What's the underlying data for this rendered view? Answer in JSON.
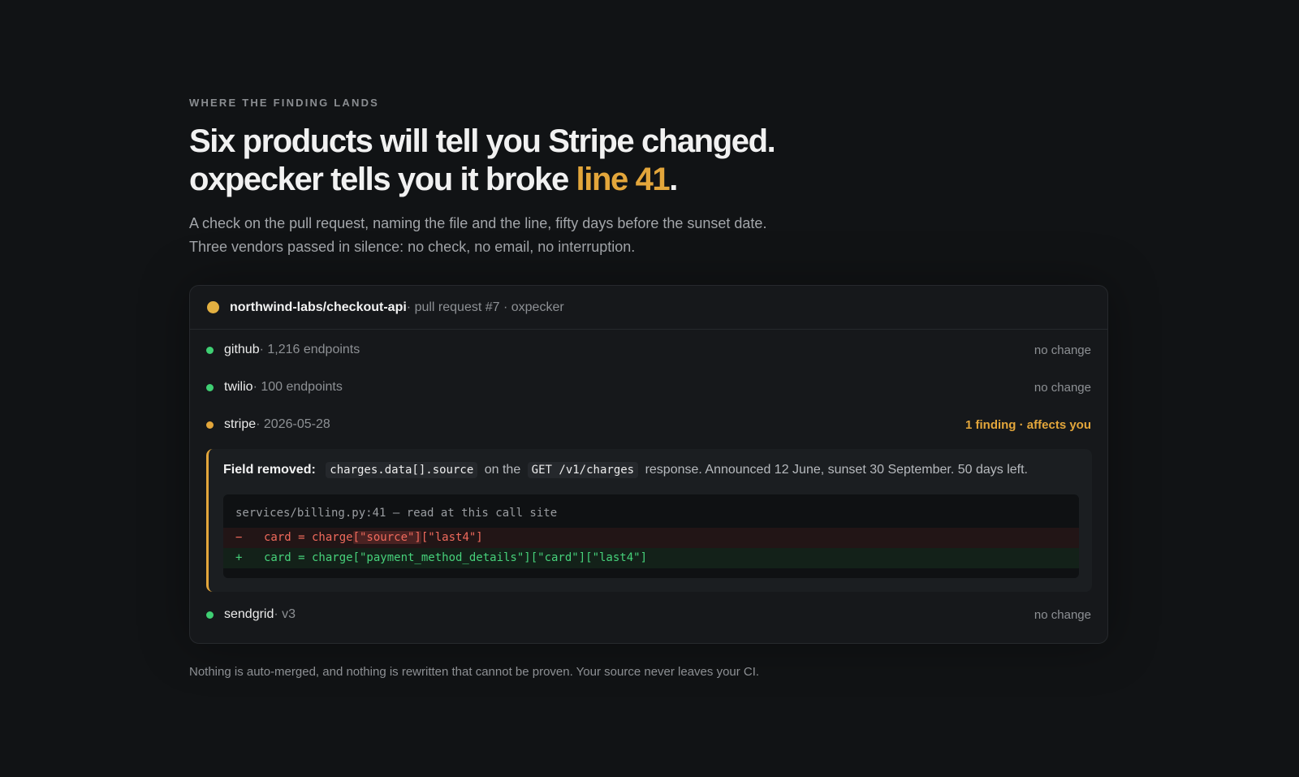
{
  "section": {
    "eyebrow": "WHERE THE FINDING LANDS",
    "headline_line1": "Six products will tell you Stripe changed.",
    "headline_line2_prefix": "oxpecker tells you it broke ",
    "headline_line2_accent": "line 41",
    "headline_line2_suffix": ".",
    "subtitle_line1": "A check on the pull request, naming the file and the line, fifty days before the sunset date.",
    "subtitle_line2": "Three vendors passed in silence: no check, no email, no interruption.",
    "footnote": "Nothing is auto-merged, and nothing is rewritten that cannot be proven. Your source never leaves your CI."
  },
  "card": {
    "repo": "northwind-labs/checkout-api",
    "meta": " · pull request #7 · oxpecker",
    "vendors": [
      {
        "name": "github",
        "detail": " · 1,216 endpoints",
        "status": "no change",
        "state": "ok"
      },
      {
        "name": "twilio",
        "detail": " · 100 endpoints",
        "status": "no change",
        "state": "ok"
      },
      {
        "name": "stripe",
        "detail": " · 2026-05-28",
        "status": "1 finding · affects you",
        "state": "finding"
      },
      {
        "name": "sendgrid",
        "detail": " · v3",
        "status": "no change",
        "state": "ok"
      }
    ],
    "finding": {
      "label": "Field removed:",
      "field": "charges.data[].source",
      "on_the": "on the",
      "endpoint": "GET /v1/charges",
      "rest": "response. Announced 12 June, sunset 30 September. 50 days left.",
      "code": {
        "location": "services/billing.py:41 — read at this call site",
        "del_sign": "−",
        "del_before": "card = charge",
        "del_highlight": "[\"source\"]",
        "del_after": "[\"last4\"]",
        "add_sign": "+",
        "add_line": "card = charge[\"payment_method_details\"][\"card\"][\"last4\"]"
      }
    }
  },
  "colors": {
    "background": "#111315",
    "accent": "#e3a63b",
    "ok": "#3fcf73",
    "removed": "#f06a5c",
    "added": "#46d17a"
  }
}
